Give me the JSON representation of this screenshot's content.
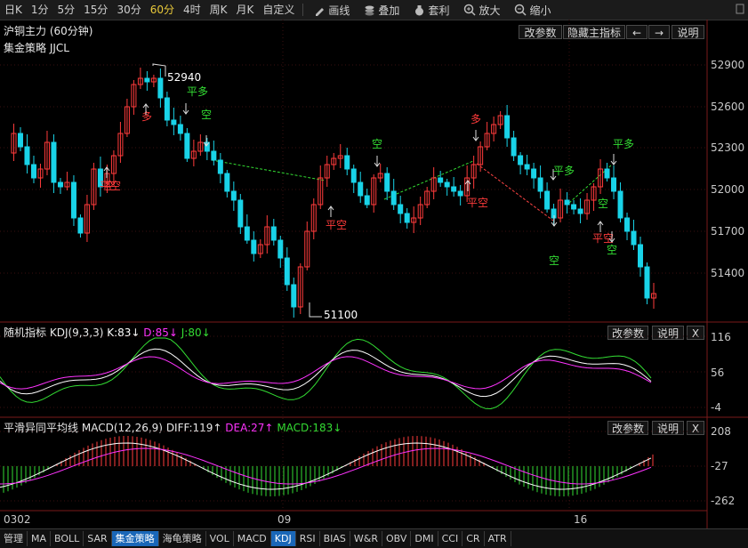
{
  "toolbar": {
    "periods": [
      "日K",
      "1分",
      "5分",
      "15分",
      "30分",
      "60分",
      "4时",
      "周K",
      "月K",
      "自定义"
    ],
    "active_period": "60分",
    "tools": [
      {
        "label": "画线",
        "icon": "pencil-icon"
      },
      {
        "label": "叠加",
        "icon": "stack-icon"
      },
      {
        "label": "套利",
        "icon": "moneybag-icon"
      },
      {
        "label": "放大",
        "icon": "zoom-in-icon"
      },
      {
        "label": "缩小",
        "icon": "zoom-out-icon"
      }
    ]
  },
  "main": {
    "title": "沪铜主力 (60分钟)",
    "strategy": "集金策略 JJCL",
    "buttons": {
      "edit_params": "改参数",
      "hide_indicator": "隐藏主指标",
      "prev": "←",
      "next": "→",
      "help": "说明"
    },
    "y_ticks": [
      "52900",
      "52600",
      "52300",
      "52000",
      "51700",
      "51400"
    ],
    "high_label": "52940",
    "low_label": "51100",
    "signals": [
      "多",
      "平多",
      "空",
      "空",
      "平空",
      "空",
      "多",
      "平空",
      "空",
      "平多",
      "空",
      "平多",
      "空",
      "平空",
      "空"
    ]
  },
  "kdj": {
    "name": "随机指标",
    "params": "KDJ(9,3,3)",
    "k": "K:83↓",
    "d": "D:85↓",
    "j": "J:80↓",
    "y_ticks": [
      "116",
      "56",
      "-4"
    ],
    "buttons": {
      "edit_params": "改参数",
      "help": "说明",
      "close": "X"
    }
  },
  "macd": {
    "name": "平滑异同平均线",
    "params": "MACD(12,26,9)",
    "diff": "DIFF:119↑",
    "dea": "DEA:27↑",
    "macd": "MACD:183↓",
    "y_ticks": [
      "208",
      "-27",
      "-262"
    ],
    "buttons": {
      "edit_params": "改参数",
      "help": "说明",
      "close": "X"
    }
  },
  "x_axis": {
    "labels": [
      "0302",
      "09",
      "16"
    ]
  },
  "bottom_tabs": [
    "管理",
    "MA",
    "BOLL",
    "SAR",
    "集金策略",
    "海龟策略",
    "VOL",
    "MACD",
    "KDJ",
    "RSI",
    "BIAS",
    "W&R",
    "OBV",
    "DMI",
    "CCI",
    "CR",
    "ATR"
  ],
  "active_tab": "集金策略",
  "colors": {
    "up": "#ff3b3b",
    "down": "#19d3e8",
    "k": "#ffffff",
    "d": "#ff33ff",
    "j": "#33dd33",
    "accent": "#e9c93a",
    "active_tab": "#1a67b8"
  }
}
